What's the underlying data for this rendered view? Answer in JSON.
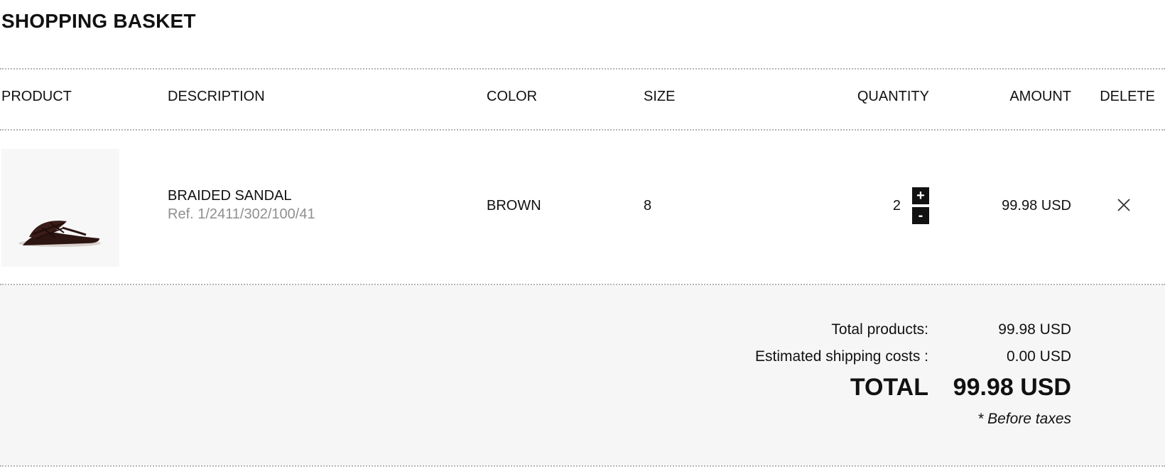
{
  "page": {
    "title": "SHOPPING BASKET"
  },
  "table": {
    "headers": {
      "product": "PRODUCT",
      "description": "DESCRIPTION",
      "color": "COLOR",
      "size": "SIZE",
      "quantity": "QUANTITY",
      "amount": "AMOUNT",
      "delete": "DELETE"
    },
    "items": [
      {
        "name": "BRAIDED SANDAL",
        "ref": "Ref. 1/2411/302/100/41",
        "color": "BROWN",
        "size": "8",
        "quantity": "2",
        "amount": "99.98 USD",
        "image_icon": "sandal-image",
        "increase_label": "+",
        "decrease_label": "-",
        "delete_icon": "close-icon"
      }
    ]
  },
  "summary": {
    "total_products_label": "Total products:",
    "total_products_value": "99.98 USD",
    "shipping_label": "Estimated shipping costs :",
    "shipping_value": "0.00 USD",
    "total_label": "TOTAL",
    "total_value": "99.98 USD",
    "taxes_note": "* Before taxes"
  },
  "colors": {
    "text": "#111111",
    "ref_text": "#8f8f8f",
    "summary_bg": "#f6f6f6",
    "thumbnail_bg": "#f7f7f7",
    "rule": "#b5b5b5"
  }
}
